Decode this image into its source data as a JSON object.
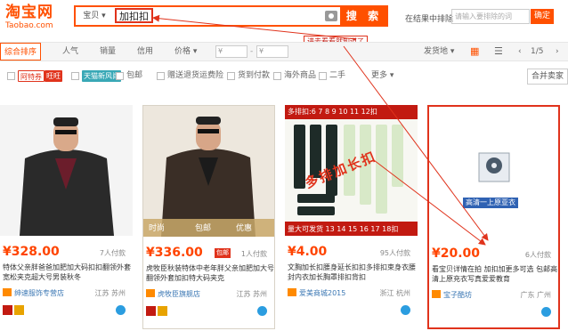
{
  "header": {
    "logo_cn": "淘宝网",
    "logo_en": "Taobao.com",
    "search_category": "宝贝",
    "search_query": "加扣扣",
    "search_button": "搜 索",
    "within_label": "在结果中排除",
    "within_placeholder": "请输入要排除的词",
    "within_button": "确定"
  },
  "annotation": {
    "callout": "进去看看就知道了",
    "overlay_text": "多排加长扣"
  },
  "sort": {
    "tabs": [
      "综合排序",
      "人气",
      "销量",
      "信用",
      "价格"
    ],
    "price_from": "¥",
    "price_to": "¥",
    "ship_from": "发货地",
    "page": "1/5"
  },
  "filters": {
    "tags": [
      "阿特券",
      "旺旺",
      "天猫新风尚"
    ],
    "items": [
      "包邮",
      "赠送退货运费险",
      "货到付款",
      "海外商品",
      "二手"
    ],
    "more": "更多",
    "merge": "合并卖家"
  },
  "products": [
    {
      "price": "¥328.00",
      "pay": "7人付款",
      "title": "特体父亲胖爸爸加肥加大码扣扣翻领外套宽松夹克超大号男装秋冬",
      "shop": "绅速服饰专营店",
      "location": "江苏 苏州"
    },
    {
      "price": "¥336.00",
      "pay": "1人付款",
      "badge_left": "包邮",
      "title": "虎牧臣秋装特体中老年胖父亲加肥加大号翻领外套加扣特大码夹克",
      "shop": "虎牧臣旗舰店",
      "location": "江苏 苏州",
      "img_tag1": "时尚",
      "img_tag2": "包邮",
      "img_tag3": "优惠"
    },
    {
      "price": "¥4.00",
      "pay": "95人付款",
      "title": "文胸加长扣腰身延长扣扣多排扣束身衣腰封内衣加长胸罩排扣背扣",
      "shop": "爱美商城2015",
      "location": "浙江 杭州",
      "img_top": "多排扣:6 7 8 9 10 11 12扣",
      "img_bottom": "量大可发货 13 14 15 16 17 18扣"
    },
    {
      "price": "¥20.00",
      "pay": "6人付款",
      "title": "看宝贝详情在拍 加扣加更多可选 包邮高清上原充衣写真爱爱教育",
      "shop": "宝子酷坊",
      "location": "广东 广州",
      "video_caption": "高清一上原亚衣"
    }
  ],
  "colors": {
    "accent": "#ff5000",
    "annotation_red": "#e0331c",
    "price": "#ff4400"
  }
}
